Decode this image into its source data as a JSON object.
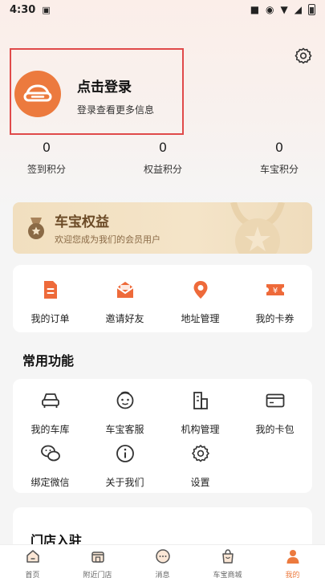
{
  "status_bar": {
    "time": "4:30"
  },
  "login": {
    "title": "点击登录",
    "subtitle": "登录查看更多信息"
  },
  "stats": [
    {
      "value": "0",
      "label": "签到积分"
    },
    {
      "value": "0",
      "label": "权益积分"
    },
    {
      "value": "0",
      "label": "车宝积分"
    }
  ],
  "vip": {
    "title": "车宝权益",
    "subtitle": "欢迎您成为我们的会员用户"
  },
  "quick_actions": [
    {
      "label": "我的订单",
      "icon": "order-icon"
    },
    {
      "label": "邀请好友",
      "icon": "invite-icon"
    },
    {
      "label": "地址管理",
      "icon": "location-icon"
    },
    {
      "label": "我的卡券",
      "icon": "coupon-icon"
    }
  ],
  "common": {
    "title": "常用功能",
    "items": [
      {
        "label": "我的车库",
        "icon": "car-icon"
      },
      {
        "label": "车宝客服",
        "icon": "service-icon"
      },
      {
        "label": "机构管理",
        "icon": "building-icon"
      },
      {
        "label": "我的卡包",
        "icon": "card-icon"
      },
      {
        "label": "绑定微信",
        "icon": "wechat-icon"
      },
      {
        "label": "关于我们",
        "icon": "info-icon"
      },
      {
        "label": "设置",
        "icon": "gear-icon"
      }
    ]
  },
  "store": {
    "title": "门店入驻"
  },
  "tabbar": [
    {
      "label": "首页",
      "icon": "home-icon"
    },
    {
      "label": "附近门店",
      "icon": "store-icon"
    },
    {
      "label": "消息",
      "icon": "message-icon"
    },
    {
      "label": "车宝商城",
      "icon": "mall-icon"
    },
    {
      "label": "我的",
      "icon": "profile-icon",
      "active": true
    }
  ],
  "colors": {
    "accent": "#ec7a3e",
    "highlight_border": "#e04a4a",
    "vip_text": "#6b4a26"
  }
}
